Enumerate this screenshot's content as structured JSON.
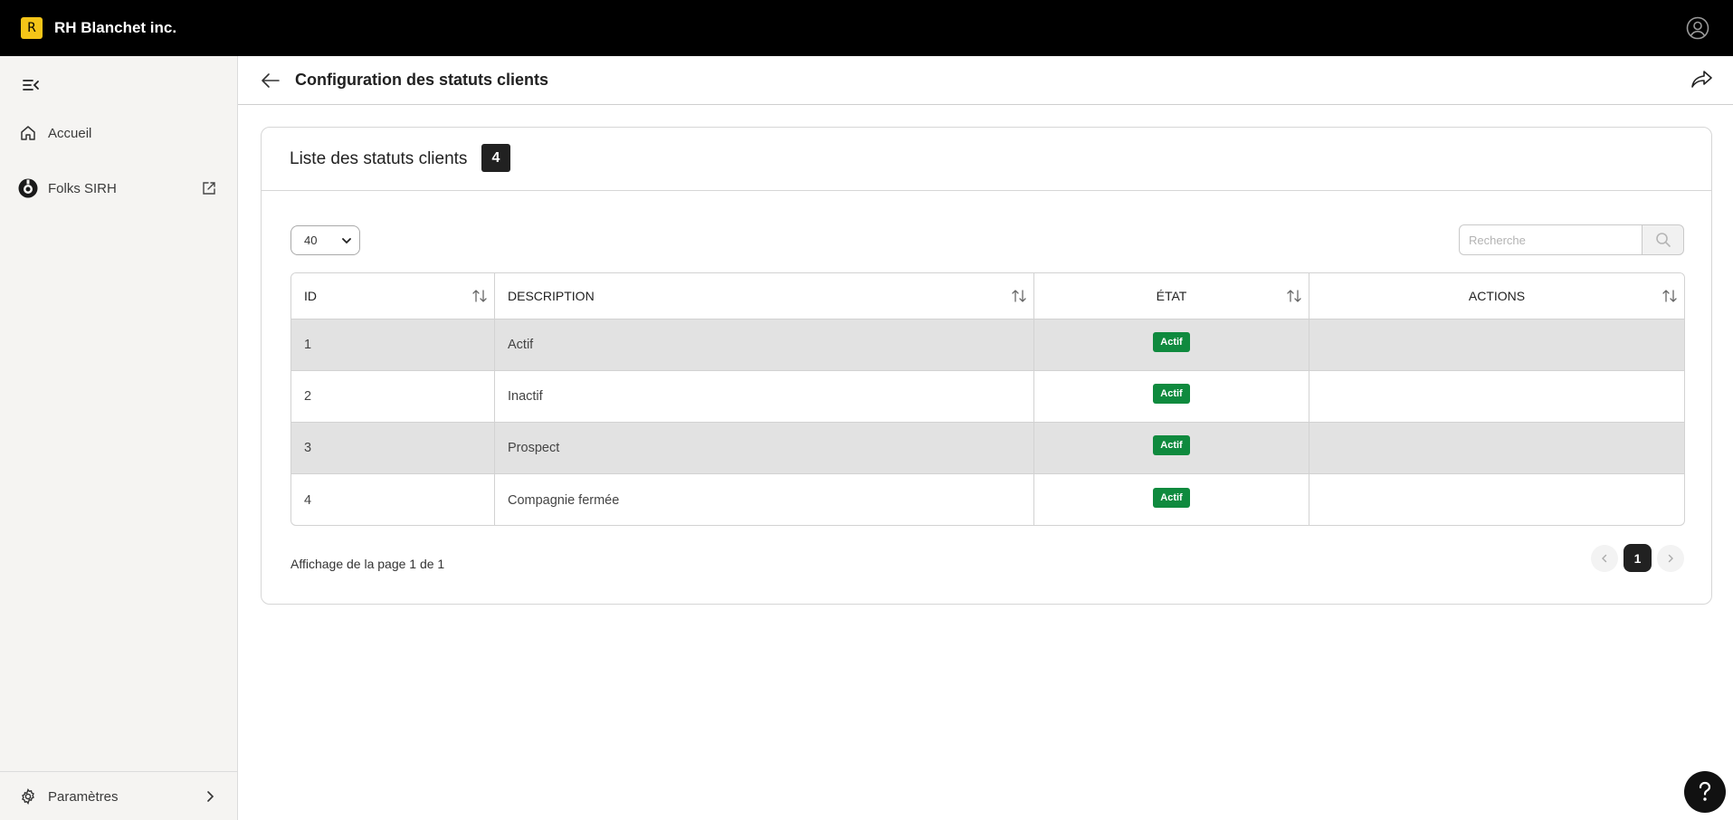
{
  "app": {
    "logo_letter": "R",
    "brand": "RH Blanchet inc."
  },
  "icons": {
    "user": "user-circle-icon",
    "collapse": "collapse-menu-icon",
    "home": "home-icon",
    "folks": "folks-logo-icon",
    "external": "external-link-icon",
    "settings": "gear-icon",
    "back": "arrow-left-icon",
    "share": "share-icon",
    "search": "search-icon",
    "help": "question-icon"
  },
  "sidebar": {
    "items": [
      {
        "label": "Accueil"
      },
      {
        "label": "Folks SIRH"
      }
    ],
    "settings_label": "Paramètres"
  },
  "header": {
    "title": "Configuration des statuts clients"
  },
  "card": {
    "title": "Liste des statuts clients",
    "count": "4",
    "per_page": "40",
    "search_placeholder": "Recherche"
  },
  "table": {
    "columns": [
      "ID",
      "DESCRIPTION",
      "ÉTAT",
      "ACTIONS"
    ],
    "rows": [
      {
        "id": "1",
        "description": "Actif",
        "state": "Actif"
      },
      {
        "id": "2",
        "description": "Inactif",
        "state": "Actif"
      },
      {
        "id": "3",
        "description": "Prospect",
        "state": "Actif"
      },
      {
        "id": "4",
        "description": "Compagnie fermée",
        "state": "Actif"
      }
    ]
  },
  "pagination": {
    "info": "Affichage de la page 1 de 1",
    "current": "1"
  },
  "colors": {
    "topbar": "#000000",
    "accent": "#f5c518",
    "status_active": "#0f8a3e",
    "row_alt": "#e2e2e2"
  }
}
